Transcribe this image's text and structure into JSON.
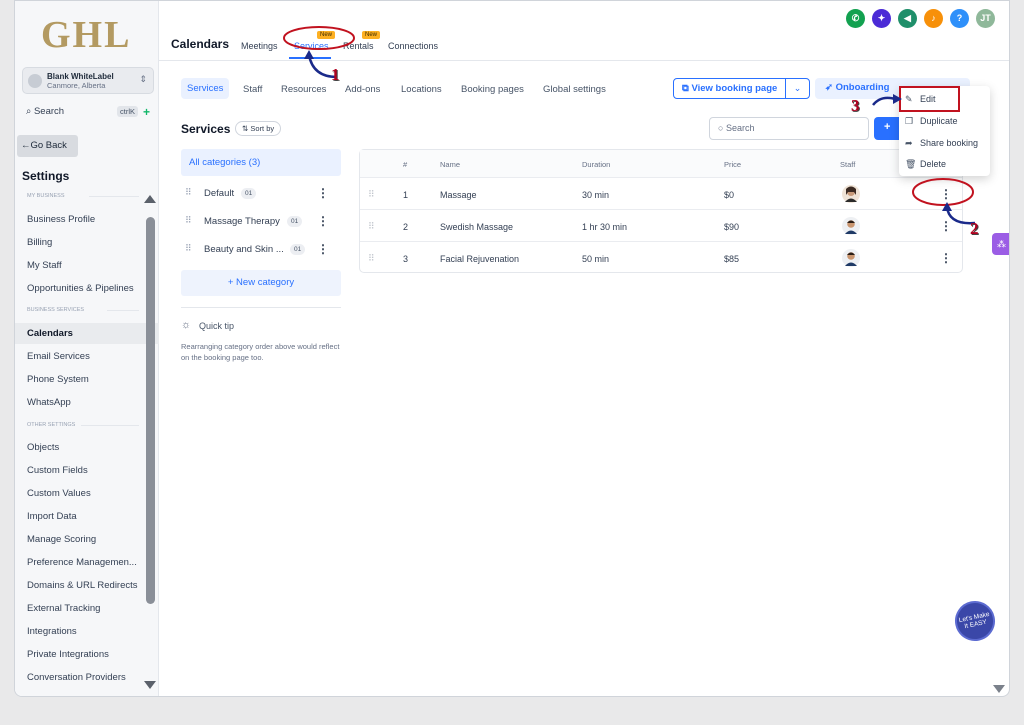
{
  "brand": {
    "logo_text": "GHL"
  },
  "account": {
    "name": "Blank WhiteLabel",
    "location": "Canmore, Alberta"
  },
  "sidebar": {
    "search_label": "Search",
    "search_shortcut": "ctrlK",
    "go_back": "Go Back",
    "settings_title": "Settings",
    "section_my_business": "MY BUSINESS",
    "section_business_services": "BUSINESS SERVICES",
    "section_other_settings": "OTHER SETTINGS",
    "items_my_business": [
      "Business Profile",
      "Billing",
      "My Staff",
      "Opportunities & Pipelines"
    ],
    "items_business_services": [
      "Calendars",
      "Email Services",
      "Phone System",
      "WhatsApp"
    ],
    "items_other": [
      "Objects",
      "Custom Fields",
      "Custom Values",
      "Import Data",
      "Manage Scoring",
      "Preference Managemen...",
      "Domains & URL Redirects",
      "External Tracking",
      "Integrations",
      "Private Integrations",
      "Conversation Providers"
    ],
    "active_item": "Calendars"
  },
  "header": {
    "title": "Calendars",
    "tabs": [
      "Meetings",
      "Services",
      "Rentals",
      "Connections"
    ],
    "active_tab": "Services",
    "new_badge": "New",
    "avatar_initials": "JT",
    "help_glyph": "?"
  },
  "subnav": {
    "tabs": [
      "Services",
      "Staff",
      "Resources",
      "Add-ons",
      "Locations",
      "Booking pages",
      "Global settings"
    ],
    "active": "Services",
    "view_booking_page": "View booking page",
    "onboarding": "Onboarding"
  },
  "services_panel": {
    "title": "Services",
    "sort_by": "Sort by",
    "search_placeholder": "Search",
    "add_glyph": "+"
  },
  "categories": {
    "all": "All categories (3)",
    "items": [
      {
        "name": "Default",
        "count": "01"
      },
      {
        "name": "Massage Therapy",
        "count": "01"
      },
      {
        "name": "Beauty and Skin ...",
        "count": "01"
      }
    ],
    "new_category": "+ New category",
    "quick_tip_title": "Quick tip",
    "quick_tip_text": "Rearranging category order above would reflect on the booking page too."
  },
  "table": {
    "headers": [
      "#",
      "Name",
      "Duration",
      "Price",
      "Staff"
    ],
    "rows": [
      {
        "num": "1",
        "name": "Massage",
        "duration": "30 min",
        "price": "$0"
      },
      {
        "num": "2",
        "name": "Swedish Massage",
        "duration": "1 hr 30 min",
        "price": "$90"
      },
      {
        "num": "3",
        "name": "Facial Rejuvenation",
        "duration": "50 min",
        "price": "$85"
      }
    ]
  },
  "context_menu": {
    "items": [
      "Edit",
      "Duplicate",
      "Share booking",
      "Delete"
    ]
  },
  "annotations": [
    "1",
    "2",
    "3"
  ],
  "fab_text": "Let's Make It EASY",
  "colors": {
    "primary": "#2970ff",
    "annotation_red": "#c1121f",
    "logo_gold": "#b39a62",
    "badge_yellow": "#fdb022"
  }
}
